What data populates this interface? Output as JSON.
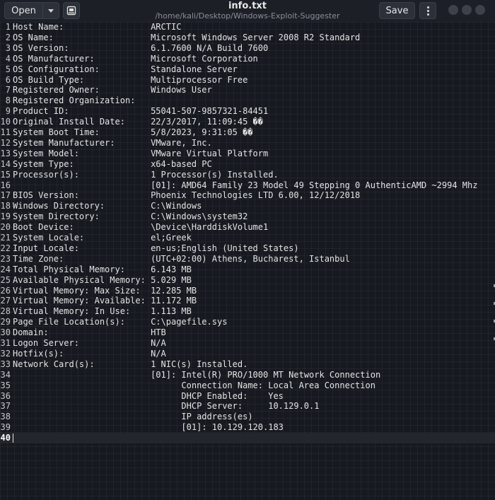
{
  "toolbar": {
    "open_label": "Open",
    "save_label": "Save"
  },
  "window": {
    "title": "info.txt",
    "path": "/home/kali/Desktop/Windows-Exploit-Suggester"
  },
  "editor": {
    "lines": [
      "Host Name:                 ARCTIC",
      "OS Name:                   Microsoft Windows Server 2008 R2 Standard",
      "OS Version:                6.1.7600 N/A Build 7600",
      "OS Manufacturer:           Microsoft Corporation",
      "OS Configuration:          Standalone Server",
      "OS Build Type:             Multiprocessor Free",
      "Registered Owner:          Windows User",
      "Registered Organization:",
      "Product ID:                55041-507-9857321-84451",
      "Original Install Date:     22/3/2017, 11:09:45 ��",
      "System Boot Time:          5/8/2023, 9:31:05 ��",
      "System Manufacturer:       VMware, Inc.",
      "System Model:              VMware Virtual Platform",
      "System Type:               x64-based PC",
      "Processor(s):              1 Processor(s) Installed.",
      "                           [01]: AMD64 Family 23 Model 49 Stepping 0 AuthenticAMD ~2994 Mhz",
      "BIOS Version:              Phoenix Technologies LTD 6.00, 12/12/2018",
      "Windows Directory:         C:\\Windows",
      "System Directory:          C:\\Windows\\system32",
      "Boot Device:               \\Device\\HarddiskVolume1",
      "System Locale:             el;Greek",
      "Input Locale:              en-us;English (United States)",
      "Time Zone:                 (UTC+02:00) Athens, Bucharest, Istanbul",
      "Total Physical Memory:     6.143 MB",
      "Available Physical Memory: 5.029 MB",
      "Virtual Memory: Max Size:  12.285 MB",
      "Virtual Memory: Available: 11.172 MB",
      "Virtual Memory: In Use:    1.113 MB",
      "Page File Location(s):     C:\\pagefile.sys",
      "Domain:                    HTB",
      "Logon Server:              N/A",
      "Hotfix(s):                 N/A",
      "Network Card(s):           1 NIC(s) Installed.",
      "                           [01]: Intel(R) PRO/1000 MT Network Connection",
      "                                 Connection Name: Local Area Connection",
      "                                 DHCP Enabled:    Yes",
      "                                 DHCP Server:     10.129.0.1",
      "                                 IP address(es)",
      "                                 [01]: 10.129.120.183",
      ""
    ],
    "current_line": 40
  },
  "colors": {
    "background": "#16191f",
    "header": "#1c1f26",
    "text": "#e4e4e4"
  }
}
